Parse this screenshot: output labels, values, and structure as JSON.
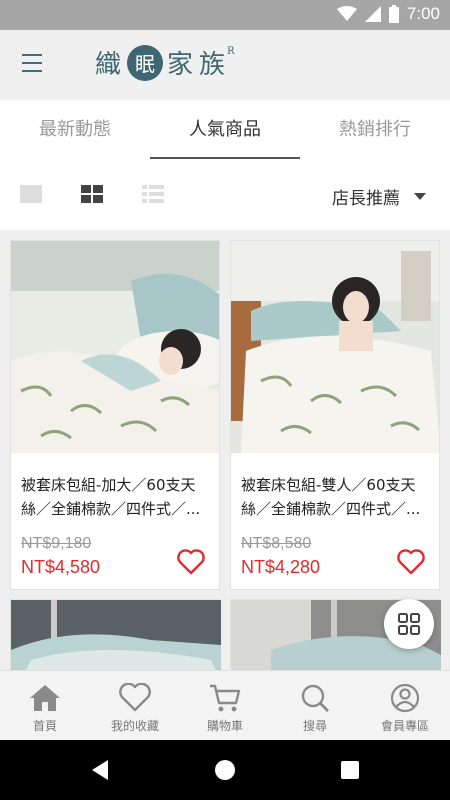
{
  "status_bar": {
    "time": "7:00"
  },
  "app_bar": {
    "brand_chars": [
      "織",
      "眠",
      "家",
      "族"
    ],
    "brand_mark": "R"
  },
  "tabs": [
    {
      "label": "最新動態"
    },
    {
      "label": "人氣商品"
    },
    {
      "label": "熱銷排行"
    }
  ],
  "toolbar": {
    "sort_label": "店長推薦"
  },
  "products": [
    {
      "title": "被套床包組-加大／60支天絲／全鋪棉款／四件式／...",
      "original_price": "NT$9,180",
      "price": "NT$4,580"
    },
    {
      "title": "被套床包組-雙人／60支天絲／全鋪棉款／四件式／...",
      "original_price": "NT$8,580",
      "price": "NT$4,280"
    }
  ],
  "bottom_nav": [
    {
      "label": "首頁",
      "icon": "home-icon"
    },
    {
      "label": "我的收藏",
      "icon": "heart-icon"
    },
    {
      "label": "購物車",
      "icon": "cart-icon"
    },
    {
      "label": "搜尋",
      "icon": "search-icon"
    },
    {
      "label": "會員專區",
      "icon": "user-icon"
    }
  ],
  "colors": {
    "brand": "#3f6772",
    "price": "#e4292f",
    "heart": "#e4292f",
    "active_tab": "#333333",
    "inactive_tab": "#9a9a9a"
  }
}
